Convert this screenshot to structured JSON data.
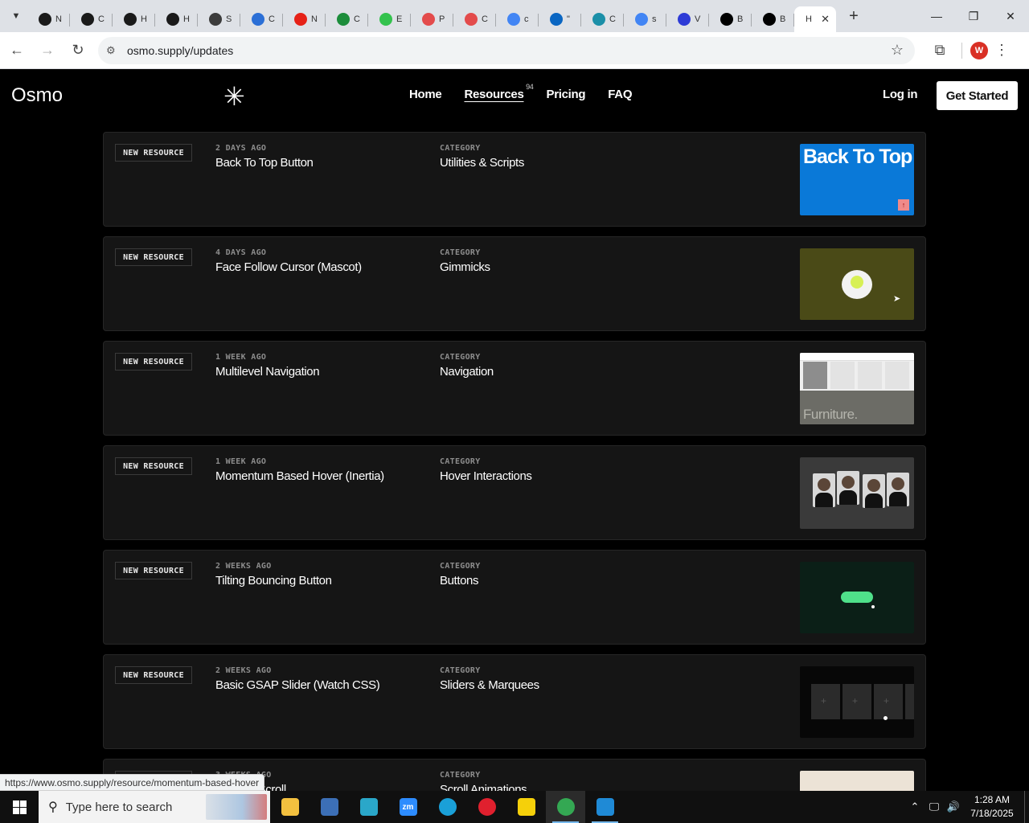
{
  "browser": {
    "tabs": [
      {
        "label": "N",
        "icon": "openai-icon",
        "color": "#1a1a1a"
      },
      {
        "label": "C",
        "icon": "openai-icon",
        "color": "#1a1a1a"
      },
      {
        "label": "H",
        "icon": "openai-icon",
        "color": "#1a1a1a"
      },
      {
        "label": "H",
        "icon": "openai-icon",
        "color": "#1a1a1a"
      },
      {
        "label": "S",
        "icon": "wordpress-icon",
        "color": "#3c3c3c"
      },
      {
        "label": "C",
        "icon": "copilot-icon",
        "color": "#2b6fd6"
      },
      {
        "label": "N",
        "icon": "youtube-icon",
        "color": "#e62117"
      },
      {
        "label": "C",
        "icon": "webflow-icon",
        "color": "#1c8d3b"
      },
      {
        "label": "E",
        "icon": "elementor-icon",
        "color": "#33c24d"
      },
      {
        "label": "P",
        "icon": "pdf-icon",
        "color": "#e34b4b"
      },
      {
        "label": "C",
        "icon": "pdf-icon",
        "color": "#e34b4b"
      },
      {
        "label": "c",
        "icon": "google-icon",
        "color": "#4285f4"
      },
      {
        "label": "\"",
        "icon": "linkedin-icon",
        "color": "#0a66c2"
      },
      {
        "label": "C",
        "icon": "copilot-icon",
        "color": "#1b8fa8"
      },
      {
        "label": "s",
        "icon": "google-icon",
        "color": "#4285f4"
      },
      {
        "label": "V",
        "icon": "x-logo-icon",
        "color": "#2d3bd6"
      },
      {
        "label": "B",
        "icon": "x-logo-icon",
        "color": "#000000"
      },
      {
        "label": "B",
        "icon": "x-logo-icon",
        "color": "#000000"
      }
    ],
    "active_tab": {
      "label": "H"
    },
    "url": "osmo.supply/updates",
    "profile_initial": "W",
    "status_url": "https://www.osmo.supply/resource/momentum-based-hover"
  },
  "site": {
    "logo": "Osmo",
    "nav": [
      {
        "label": "Home"
      },
      {
        "label": "Resources",
        "badge": "94"
      },
      {
        "label": "Pricing"
      },
      {
        "label": "FAQ"
      }
    ],
    "login": "Log in",
    "cta": "Get Started"
  },
  "labels": {
    "new_resource": "NEW RESOURCE",
    "category": "CATEGORY"
  },
  "resources": [
    {
      "age": "2 DAYS AGO",
      "title": "Back To Top Button",
      "category": "Utilities & Scripts",
      "thumb_text": "Back To Top"
    },
    {
      "age": "4 DAYS AGO",
      "title": "Face Follow Cursor (Mascot)",
      "category": "Gimmicks"
    },
    {
      "age": "1 WEEK AGO",
      "title": "Multilevel Navigation",
      "category": "Navigation",
      "thumb_text": "Furniture."
    },
    {
      "age": "1 WEEK AGO",
      "title": "Momentum Based Hover (Inertia)",
      "category": "Hover Interactions"
    },
    {
      "age": "2 WEEKS AGO",
      "title": "Tilting Bouncing Button",
      "category": "Buttons"
    },
    {
      "age": "2 WEEKS AGO",
      "title": "Basic GSAP Slider (Watch CSS)",
      "category": "Sliders & Marquees"
    },
    {
      "age": "3 WEEKS AGO",
      "title": "Path on Scroll",
      "category": "Scroll Animations"
    }
  ],
  "taskbar": {
    "search_placeholder": "Type here to search",
    "time": "1:28 AM",
    "date": "7/18/2025",
    "apps": [
      {
        "name": "file-explorer",
        "color": "#f3c03f",
        "text": ""
      },
      {
        "name": "paint",
        "color": "#3c6fb6",
        "text": ""
      },
      {
        "name": "app-diamond",
        "color": "#2aa7c9",
        "text": ""
      },
      {
        "name": "zoom",
        "color": "#2d8cff",
        "text": "zm"
      },
      {
        "name": "edge",
        "color": "#1aa0d8",
        "text": ""
      },
      {
        "name": "opera",
        "color": "#e0202e",
        "text": ""
      },
      {
        "name": "sticky-notes",
        "color": "#f5d00a",
        "text": ""
      },
      {
        "name": "chrome",
        "color": "#34a853",
        "text": ""
      },
      {
        "name": "vscode",
        "color": "#1f8ad6",
        "text": ""
      }
    ]
  }
}
